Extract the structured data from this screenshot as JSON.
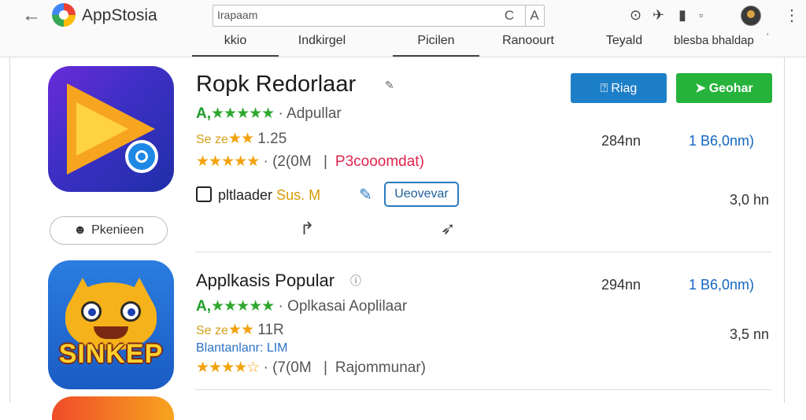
{
  "topbar": {
    "app_name": "AppStosia",
    "search": {
      "placeholder": "Irapaam"
    },
    "tabs": [
      "kkio",
      "Indkirgel",
      "Picilen",
      "Ranoourt",
      "Teyald",
      "blesba bhaldap"
    ]
  },
  "apps": [
    {
      "title": "Ropk Redorlaar",
      "rating_line": {
        "prefix": "A,",
        "stars": "★★★★★",
        "text": "Adpullar"
      },
      "score_line": {
        "label": "Se ze",
        "stars": "★★",
        "text": "1.25"
      },
      "reviews_line": {
        "stars": "★★★★★",
        "count": "(2(0M",
        "sep": "|",
        "tag": "P3cooomdat)"
      },
      "dev_line": {
        "name": "pltlaader",
        "badge": "Sus. M"
      },
      "tag_button": "Ueovevar",
      "pill_button": "Pkenieen",
      "buttons": {
        "install": "Riag",
        "other": "Geohar"
      },
      "stats": {
        "downloads": "284nn",
        "size": "1 B6,0nm)",
        "time": "3,0 hn"
      }
    },
    {
      "title": "Applkasis Popular",
      "rating_line": {
        "prefix": "A,",
        "stars": "★★★★★",
        "text": "Oplkasai  Aoplilaar"
      },
      "score_line": {
        "label": "Se ze",
        "stars": "★★",
        "text": "11R"
      },
      "category": "Blantanlanr: LIM",
      "reviews_line": {
        "stars": "★★★★☆",
        "count": "(7(0M",
        "sep": "|",
        "tag": "Rajommunar)"
      },
      "icon_text": "SINKEP",
      "stats": {
        "downloads": "294nn",
        "size": "1 B6,0nm)",
        "time": "3,5 nn"
      }
    }
  ],
  "colors": {
    "install_button": "#1e7fc9",
    "green_button": "#26b33b",
    "rating_green": "#2ea82f",
    "star_orange": "#f2a20c",
    "size_blue": "#1565c0"
  },
  "icons": [
    "back-arrow-icon",
    "store-logo-icon",
    "clear-icon",
    "font-icon",
    "clock-icon",
    "share-icon",
    "bookmark-icon",
    "avatar",
    "more-vert-icon",
    "edit-icon",
    "pencil-icon",
    "person-icon",
    "share-arrow-icon",
    "cursor-icon"
  ]
}
